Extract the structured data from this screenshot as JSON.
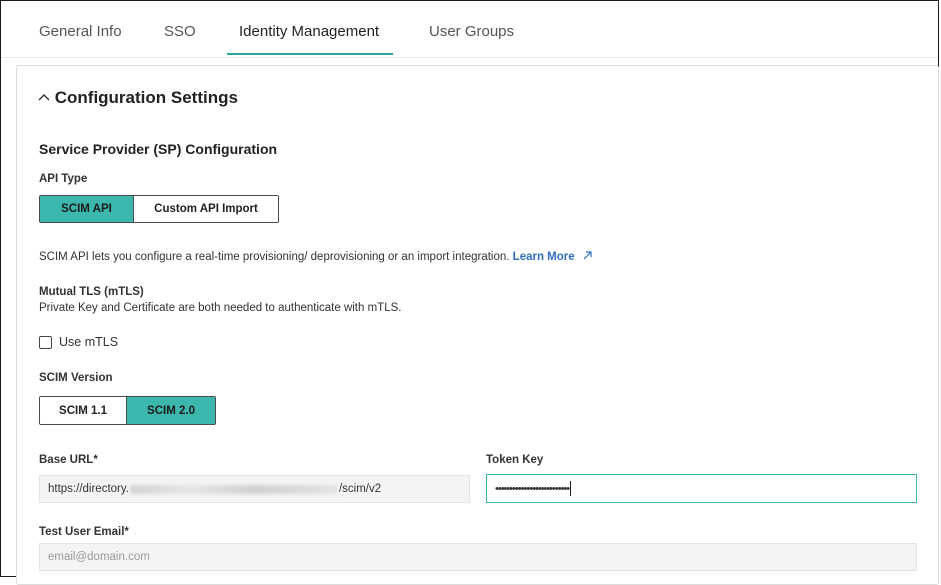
{
  "tabs": [
    {
      "label": "General Info"
    },
    {
      "label": "SSO"
    },
    {
      "label": "Identity Management"
    },
    {
      "label": "User Groups"
    }
  ],
  "config": {
    "title": "Configuration Settings",
    "collapse_icon": "chevron-up-icon"
  },
  "sp": {
    "heading": "Service Provider (SP) Configuration",
    "api_type_label": "API Type",
    "api_options": [
      "SCIM API",
      "Custom API Import"
    ],
    "api_selected": "SCIM API",
    "description": "SCIM API lets you configure a real-time provisioning/ deprovisioning or an import integration.",
    "learn_more": "Learn More",
    "learn_more_icon": "external-link-arrow-icon"
  },
  "mtls": {
    "heading": "Mutual TLS (mTLS)",
    "description": "Private Key and Certificate are both needed to authenticate with mTLS.",
    "checkbox_label": "Use mTLS",
    "checked": false
  },
  "scim_version": {
    "label": "SCIM Version",
    "options": [
      "SCIM 1.1",
      "SCIM 2.0"
    ],
    "selected": "SCIM 2.0"
  },
  "base_url": {
    "label": "Base URL*",
    "prefix": "https://directory.",
    "suffix": "/scim/v2"
  },
  "token_key": {
    "label": "Token Key",
    "masked_value": "••••••••••••••••••••••••••"
  },
  "test_email": {
    "label": "Test User Email*",
    "placeholder": "email@domain.com"
  },
  "colors": {
    "accent": "#3bb7ad",
    "link": "#2e6fc4"
  }
}
